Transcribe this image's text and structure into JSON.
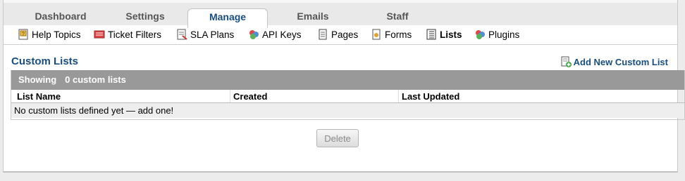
{
  "tabs": [
    {
      "label": "Dashboard",
      "active": false
    },
    {
      "label": "Settings",
      "active": false
    },
    {
      "label": "Manage",
      "active": true
    },
    {
      "label": "Emails",
      "active": false
    },
    {
      "label": "Staff",
      "active": false
    }
  ],
  "subnav": [
    {
      "label": "Help Topics",
      "icon": "help-topics-icon",
      "active": false
    },
    {
      "label": "Ticket Filters",
      "icon": "ticket-filters-icon",
      "active": false
    },
    {
      "label": "SLA Plans",
      "icon": "sla-plans-icon",
      "active": false
    },
    {
      "label": "API Keys",
      "icon": "api-keys-icon",
      "active": false
    },
    {
      "label": "Pages",
      "icon": "pages-icon",
      "active": false
    },
    {
      "label": "Forms",
      "icon": "forms-icon",
      "active": false
    },
    {
      "label": "Lists",
      "icon": "lists-icon",
      "active": true
    },
    {
      "label": "Plugins",
      "icon": "plugins-icon",
      "active": false
    }
  ],
  "page": {
    "title": "Custom Lists",
    "add_link": "Add New Custom List"
  },
  "table": {
    "showing_label": "Showing",
    "showing_count": "0 custom lists",
    "columns": [
      "List Name",
      "Created",
      "Last Updated"
    ],
    "empty_message": "No custom lists defined yet — add one!"
  },
  "actions": {
    "delete_label": "Delete"
  },
  "colors": {
    "accent": "#184e81",
    "header_bar": "#999999"
  }
}
